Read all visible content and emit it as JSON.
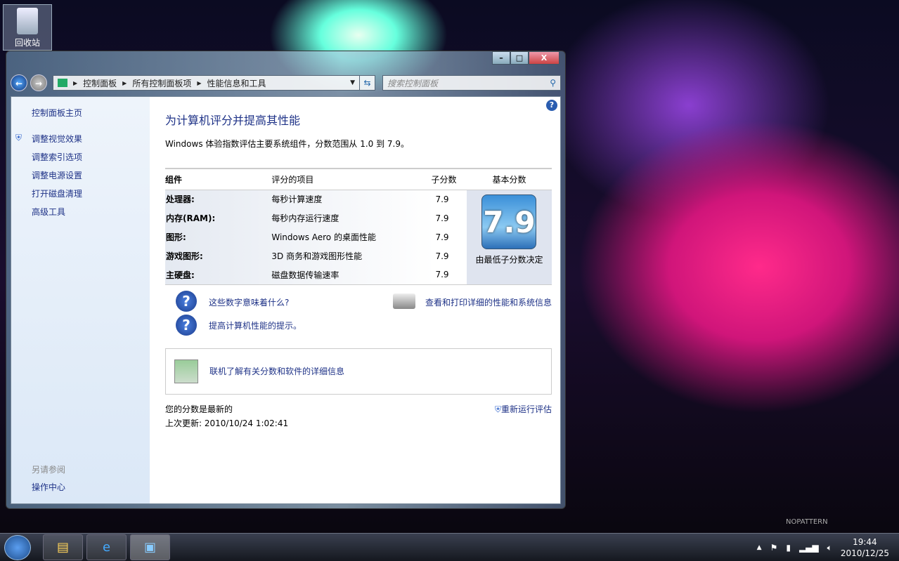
{
  "desktop": {
    "recycle_bin": "回收站",
    "watermark": "NOPATTERN"
  },
  "window": {
    "controls": {
      "minimize": "–",
      "maximize": "□",
      "close": "X"
    },
    "breadcrumb": [
      "控制面板",
      "所有控制面板项",
      "性能信息和工具"
    ],
    "search_placeholder": "搜索控制面板"
  },
  "sidebar": {
    "items": [
      "控制面板主页",
      "调整视觉效果",
      "调整索引选项",
      "调整电源设置",
      "打开磁盘清理",
      "高级工具"
    ],
    "see_also": "另请参阅",
    "action_center": "操作中心"
  },
  "main": {
    "title": "为计算机评分并提高其性能",
    "intro": "Windows 体验指数评估主要系统组件，分数范围从 1.0 到 7.9。",
    "headers": [
      "组件",
      "评分的项目",
      "子分数",
      "基本分数"
    ],
    "rows": [
      {
        "component": "处理器:",
        "item": "每秒计算速度",
        "score": "7.9"
      },
      {
        "component": "内存(RAM):",
        "item": "每秒内存运行速度",
        "score": "7.9"
      },
      {
        "component": "图形:",
        "item": "Windows Aero 的桌面性能",
        "score": "7.9"
      },
      {
        "component": "游戏图形:",
        "item": "3D 商务和游戏图形性能",
        "score": "7.9"
      },
      {
        "component": "主硬盘:",
        "item": "磁盘数据传输速率",
        "score": "7.9"
      }
    ],
    "base_score": "7.9",
    "base_note": "由最低子分数决定",
    "link_meaning": "这些数字意味着什么?",
    "link_tips": "提高计算机性能的提示。",
    "link_print": "查看和打印详细的性能和系统信息",
    "link_online": "联机了解有关分数和软件的详细信息",
    "status": "您的分数是最新的",
    "last_update": "上次更新: 2010/10/24 1:02:41",
    "rerun": "重新运行评估"
  },
  "taskbar": {
    "time": "19:44",
    "date": "2010/12/25"
  }
}
